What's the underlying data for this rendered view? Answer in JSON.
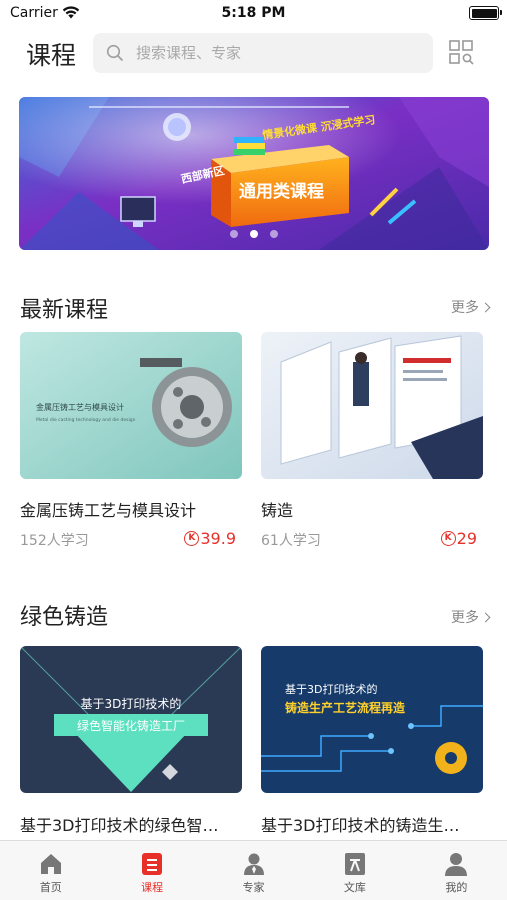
{
  "status_bar": {
    "carrier": "Carrier",
    "time": "5:18 PM"
  },
  "header": {
    "title": "课程",
    "search_placeholder": "搜索课程、专家"
  },
  "banner": {
    "headline": "通用类课程",
    "badge": "西部新区",
    "tagline": "情景化微课 沉浸式学习",
    "pages": 3,
    "active_page": 2
  },
  "sections": [
    {
      "title": "最新课程",
      "more": "更多",
      "courses": [
        {
          "title": "金属压铸工艺与模具设计",
          "learners": "152人学习",
          "price": "39.9",
          "thumb_caption": "金属压铸工艺与模具设计",
          "thumb_sub": "Metal die casting technology and die design"
        },
        {
          "title": "铸造",
          "learners": "61人学习",
          "price": "29"
        }
      ]
    },
    {
      "title": "绿色铸造",
      "more": "更多",
      "courses": [
        {
          "title": "基于3D打印技术的绿色智…",
          "thumb_line1": "基于3D打印技术的",
          "thumb_line2": "绿色智能化铸造工厂"
        },
        {
          "title": "基于3D打印技术的铸造生…",
          "thumb_line1": "基于3D打印技术的",
          "thumb_line2": "铸造生产工艺流程再造"
        }
      ]
    }
  ],
  "tabs": [
    {
      "label": "首页",
      "icon": "home-icon",
      "active": false
    },
    {
      "label": "课程",
      "icon": "course-icon",
      "active": true
    },
    {
      "label": "专家",
      "icon": "expert-icon",
      "active": false
    },
    {
      "label": "文库",
      "icon": "library-icon",
      "active": false
    },
    {
      "label": "我的",
      "icon": "profile-icon",
      "active": false
    }
  ],
  "colors": {
    "accent": "#e8302a",
    "tab_inactive": "#555555",
    "banner_purple": "#6a2bb8"
  }
}
